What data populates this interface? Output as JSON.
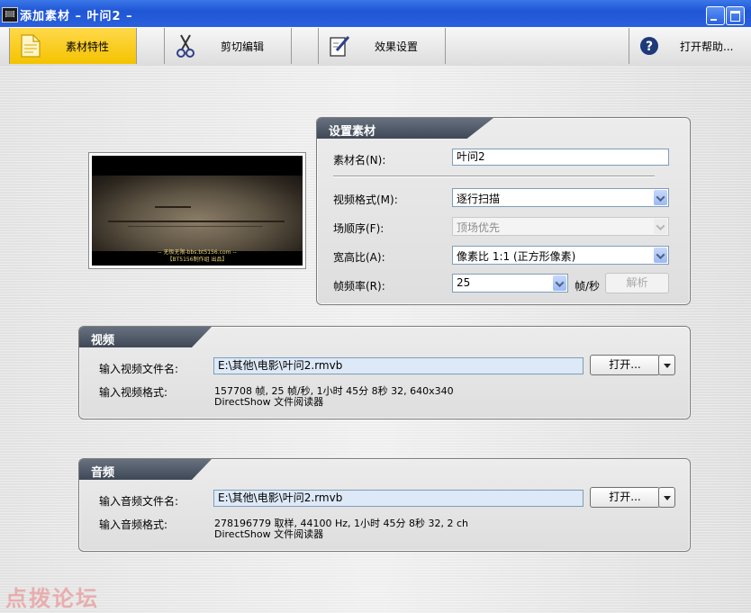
{
  "window": {
    "title": "添加素材 – 叶问2 –"
  },
  "toolbar": {
    "tabs": [
      {
        "label": "素材特性",
        "icon": "document-icon",
        "active": true
      },
      {
        "label": "剪切编辑",
        "icon": "scissors-icon",
        "active": false
      },
      {
        "label": "效果设置",
        "icon": "edit-pencil-icon",
        "active": false
      }
    ],
    "help_label": "打开帮助..."
  },
  "preview": {
    "subtitle_line1": "-- 无极无限-bbs.bt5156.com --",
    "subtitle_line2": "【BT5156制作组 出品】"
  },
  "settings": {
    "title": "设置素材",
    "name_label": "素材名(N):",
    "name_value": "叶问2",
    "video_format_label": "视频格式(M):",
    "video_format_value": "逐行扫描",
    "field_order_label": "场顺序(F):",
    "field_order_value": "顶场优先",
    "aspect_label": "宽高比(A):",
    "aspect_value": "像素比 1:1 (正方形像素)",
    "framerate_label": "帧频率(R):",
    "framerate_value": "25",
    "framerate_unit": "帧/秒",
    "analyze_button": "解析"
  },
  "video": {
    "title": "视频",
    "file_label": "输入视频文件名:",
    "file_value": "E:\\其他\\电影\\叶问2.rmvb",
    "open_button": "打开...",
    "format_label": "输入视频格式:",
    "format_line1": "157708 帧, 25 帧/秒, 1小时 45分 8秒 32, 640x340",
    "format_line2": "DirectShow 文件阅读器"
  },
  "audio": {
    "title": "音频",
    "file_label": "输入音频文件名:",
    "file_value": "E:\\其他\\电影\\叶问2.rmvb",
    "open_button": "打开...",
    "format_label": "输入音频格式:",
    "format_line1": "278196779 取样, 44100 Hz, 1小时 45分 8秒 32, 2 ch",
    "format_line2": "DirectShow 文件阅读器"
  },
  "watermark": "点拨论坛",
  "colors": {
    "titlebar": "#2a60dc",
    "active_tab": "#f4c300",
    "panel_header": "#4c5565"
  }
}
